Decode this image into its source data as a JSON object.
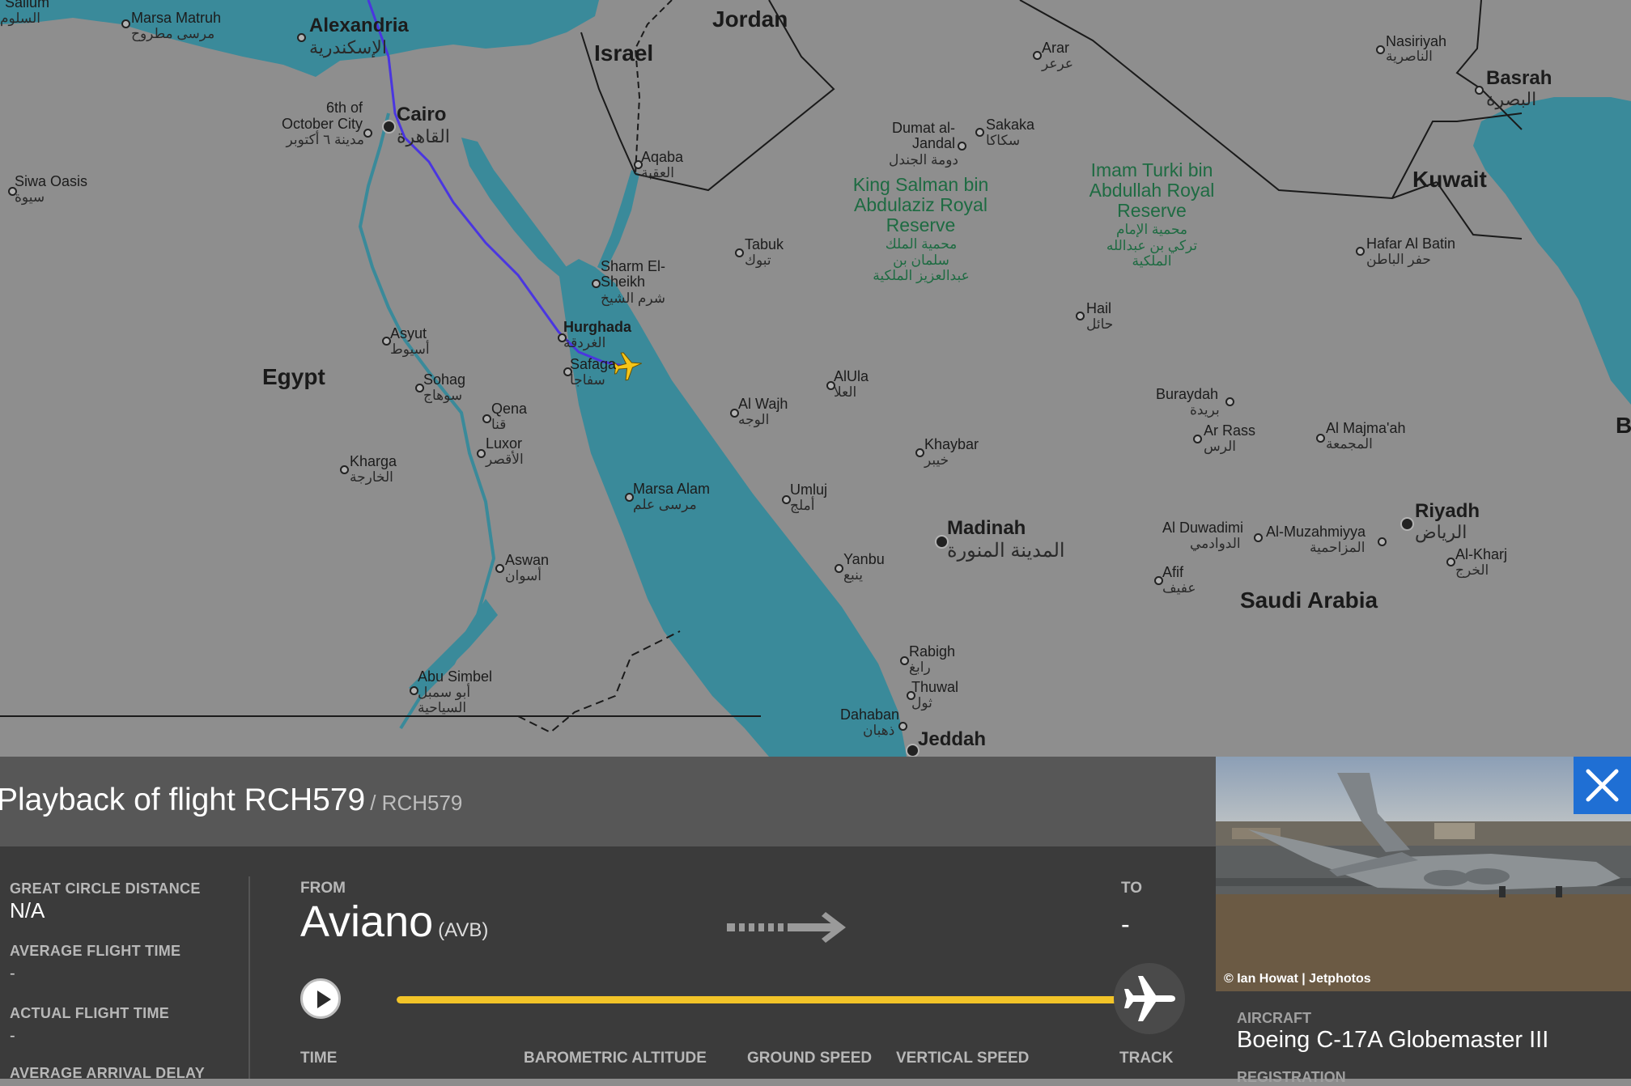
{
  "map": {
    "countries": [
      "Egypt",
      "Jordan",
      "Israel",
      "Saudi Arabia",
      "Kuwait"
    ],
    "cut_label": "B",
    "cities": [
      {
        "name": "Marsa Matruh",
        "ar": "مرسى مطروح"
      },
      {
        "name": "Alexandria",
        "ar": "الإسكندرية"
      },
      {
        "name": "Cairo",
        "ar": "القاهرة"
      },
      {
        "name": "6th of October City",
        "ar": "مدينة ٦ أكتوبر"
      },
      {
        "name": "Siwa Oasis",
        "ar": "سيوة"
      },
      {
        "name": "Aqaba",
        "ar": "العقبة"
      },
      {
        "name": "Sharm El-Sheikh",
        "ar": "شرم الشيخ"
      },
      {
        "name": "Hurghada",
        "ar": "الغردقة"
      },
      {
        "name": "Safaga",
        "ar": "سفاجا"
      },
      {
        "name": "Asyut",
        "ar": "أسيوط"
      },
      {
        "name": "Sohag",
        "ar": "سوهاج"
      },
      {
        "name": "Qena",
        "ar": "قنا"
      },
      {
        "name": "Luxor",
        "ar": "الأقصر"
      },
      {
        "name": "Kharga",
        "ar": "الخارجة"
      },
      {
        "name": "Marsa Alam",
        "ar": "مرسى علم"
      },
      {
        "name": "Aswan",
        "ar": "أسوان"
      },
      {
        "name": "Abu Simbel",
        "ar": "أبو سمبل السياحية"
      },
      {
        "name": "Tabuk",
        "ar": "تبوك"
      },
      {
        "name": "Al Wajh",
        "ar": "الوجه"
      },
      {
        "name": "AlUla",
        "ar": "العلا"
      },
      {
        "name": "Umluj",
        "ar": "أملج"
      },
      {
        "name": "Khaybar",
        "ar": "خيبر"
      },
      {
        "name": "Madinah",
        "ar": "المدينة المنورة"
      },
      {
        "name": "Yanbu",
        "ar": "ينبع"
      },
      {
        "name": "Rabigh",
        "ar": "رابغ"
      },
      {
        "name": "Thuwal",
        "ar": "ثول"
      },
      {
        "name": "Dahaban",
        "ar": "ذهبان"
      },
      {
        "name": "Jeddah",
        "ar": ""
      },
      {
        "name": "Arar",
        "ar": "عرعر"
      },
      {
        "name": "Dumat al-Jandal",
        "ar": "دومة الجندل"
      },
      {
        "name": "Sakaka",
        "ar": "سكاكا"
      },
      {
        "name": "Hail",
        "ar": "حائل"
      },
      {
        "name": "Buraydah",
        "ar": "بريدة"
      },
      {
        "name": "Ar Rass",
        "ar": "الرس"
      },
      {
        "name": "Al Majma'ah",
        "ar": "المجمعة"
      },
      {
        "name": "Riyadh",
        "ar": "الرياض"
      },
      {
        "name": "Al Duwadimi",
        "ar": "الدوادمي"
      },
      {
        "name": "Al-Muzahmiyya",
        "ar": "المزاحمية"
      },
      {
        "name": "Al-Kharj",
        "ar": "الخرج"
      },
      {
        "name": "Afif",
        "ar": "عفيف"
      },
      {
        "name": "Nasiriyah",
        "ar": "الناصرية"
      },
      {
        "name": "Basrah",
        "ar": "البصرة"
      },
      {
        "name": "Hafar Al Batin",
        "ar": "حفر الباطن"
      },
      {
        "name": "Sallum",
        "ar": "السلوم"
      }
    ],
    "reserves": [
      {
        "name": "King Salman bin Abdulaziz Royal Reserve",
        "ar": "محمية الملك سلمان بن عبدالعزيز الملكية"
      },
      {
        "name": "Imam Turki bin Abdullah Royal Reserve",
        "ar": "محمية الإمام تركي بن عبدالله الملكية"
      }
    ],
    "colors": {
      "land": "#8e8e8e",
      "water": "#3a8a9a",
      "track": "#4a36e0",
      "plane": "#f5c518"
    }
  },
  "panel": {
    "title": "Playback of flight RCH579",
    "subtitle": "/ RCH579",
    "stats": [
      {
        "label": "GREAT CIRCLE DISTANCE",
        "value": "N/A"
      },
      {
        "label": "AVERAGE FLIGHT TIME",
        "value": "-"
      },
      {
        "label": "ACTUAL FLIGHT TIME",
        "value": "-"
      },
      {
        "label": "AVERAGE ARRIVAL DELAY",
        "value": ""
      }
    ],
    "from_label": "FROM",
    "from_city": "Aviano",
    "from_code": "(AVB)",
    "to_label": "TO",
    "to_value": "-",
    "playback_progress_pct": 97,
    "columns": [
      "TIME",
      "BAROMETRIC ALTITUDE",
      "GROUND SPEED",
      "VERTICAL SPEED",
      "TRACK"
    ],
    "accent": "#f2c428"
  },
  "aircraft": {
    "photo_credit": "© Ian Howat | Jetphotos",
    "label": "AIRCRAFT",
    "value": "Boeing C-17A Globemaster III",
    "reg_label": "REGISTRATION",
    "close_color": "#1f6fd4"
  }
}
